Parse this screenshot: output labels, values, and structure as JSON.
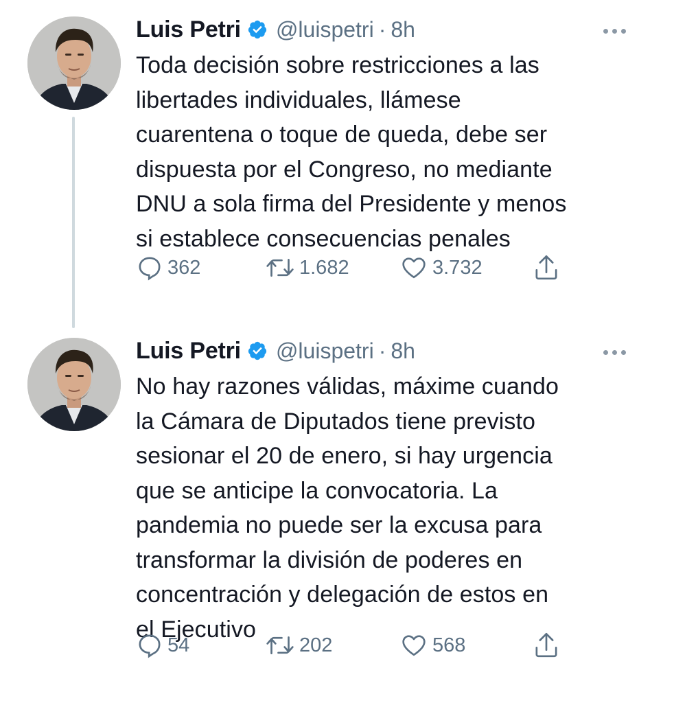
{
  "tweets": [
    {
      "name": "Luis Petri",
      "handle": "@luispetri",
      "separator": "·",
      "time": "8h",
      "text": "Toda decisión sobre restricciones a las\nlibertades individuales, llámese\ncuarentena o toque de queda, debe ser\ndispuesta por el Congreso, no mediante\nDNU a sola firma del Presidente y menos\nsi establece consecuencias penales",
      "replies": "362",
      "retweets": "1.682",
      "likes": "3.732"
    },
    {
      "name": "Luis Petri",
      "handle": "@luispetri",
      "separator": "·",
      "time": "8h",
      "text": "No hay razones válidas, máxime cuando\nla Cámara de Diputados tiene previsto\nsesionar el 20 de enero, si hay urgencia\nque se anticipe la convocatoria. La\npandemia no puede ser la excusa para\ntransformar la división de poderes en\nconcentración y delegación de estos en\nel Ejecutivo",
      "replies": "54",
      "retweets": "202",
      "likes": "568"
    }
  ],
  "icons": {
    "verified": "verified-badge-icon",
    "more": "more-dots-icon",
    "reply": "reply-bubble-icon",
    "retweet": "retweet-arrows-icon",
    "like": "heart-icon",
    "share": "share-upload-icon"
  },
  "colors": {
    "verified": "#1d9bf0",
    "secondary_text": "#5b7083",
    "thread_line": "#cfd9de"
  }
}
